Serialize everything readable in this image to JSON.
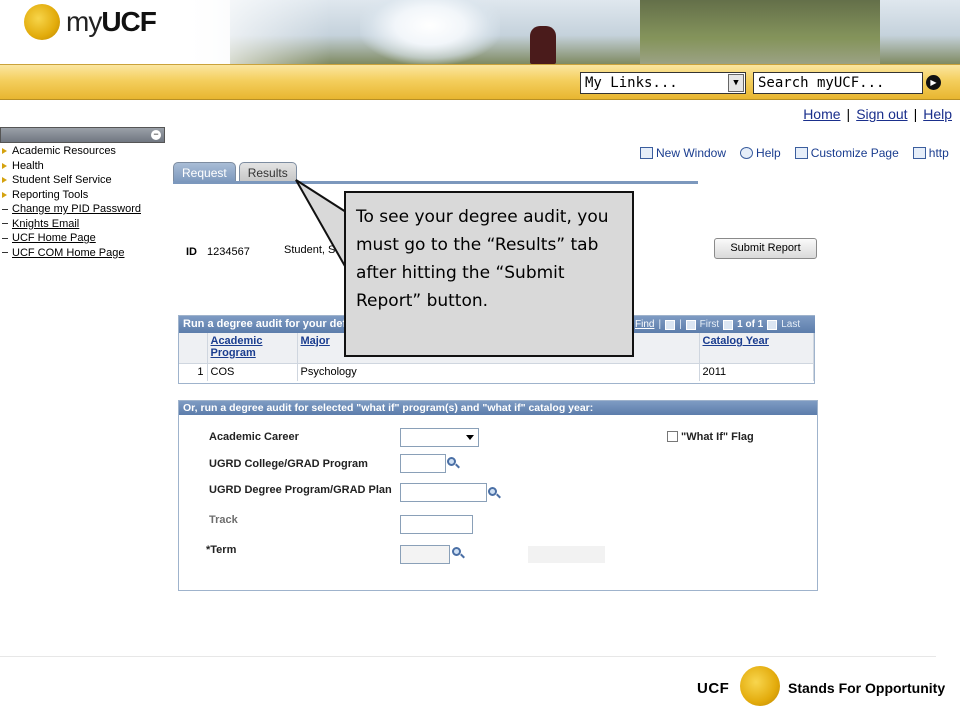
{
  "header": {
    "logo_prefix": "my",
    "logo_suffix": "UCF",
    "my_links": "My Links...",
    "search_placeholder": "Search myUCF..."
  },
  "top_links": [
    "Home",
    "Sign out",
    "Help"
  ],
  "sidebar": {
    "items": [
      {
        "label": "Academic Resources",
        "kind": "folder"
      },
      {
        "label": "Health",
        "kind": "folder"
      },
      {
        "label": "Student Self Service",
        "kind": "folder"
      },
      {
        "label": "Reporting Tools",
        "kind": "folder"
      },
      {
        "label": "Change my PID Password",
        "kind": "link"
      },
      {
        "label": "Knights Email",
        "kind": "link"
      },
      {
        "label": "UCF Home Page",
        "kind": "link"
      },
      {
        "label": "UCF COM Home Page",
        "kind": "link"
      }
    ]
  },
  "actions": [
    "New Window",
    "Help",
    "Customize Page",
    "http"
  ],
  "tabs": {
    "request": "Request",
    "results": "Results"
  },
  "student": {
    "id_label": "ID",
    "id_value": "1234567",
    "name": "Student, St"
  },
  "submit_label": "Submit Report",
  "grid1": {
    "title": "Run a degree audit for your defa",
    "find": "Find",
    "first": "First",
    "range": "1 of 1",
    "last": "Last",
    "headers": {
      "program": "Academic Program",
      "major": "Major",
      "catalog": "Catalog Year"
    },
    "row": {
      "num": "1",
      "program": "COS",
      "major": "Psychology",
      "catalog": "2011"
    }
  },
  "grid2": {
    "title": "Or, run a degree audit for selected \"what if\" program(s) and \"what if\" catalog year:",
    "academic_career": "Academic Career",
    "what_if_flag": "\"What If\" Flag",
    "college_program": "UGRD College/GRAD Program",
    "degree_program": "UGRD Degree Program/GRAD Plan",
    "track": "Track",
    "term": "*Term"
  },
  "callout": "To see your degree audit, you must go to the “Results” tab after hitting the “Submit Report” button.",
  "footer": {
    "ucf": "UCF",
    "tagline": "Stands For Opportunity"
  }
}
